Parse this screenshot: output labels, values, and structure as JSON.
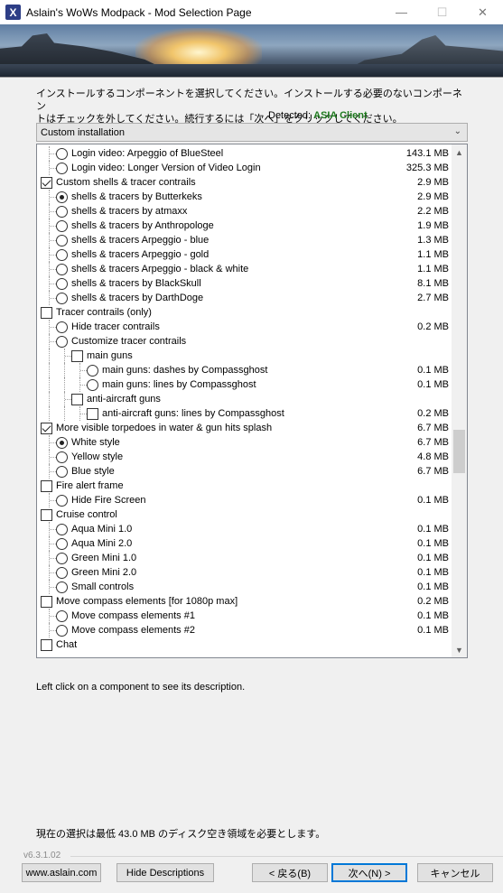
{
  "window": {
    "title": "Aslain's WoWs Modpack - Mod Selection Page",
    "icon": "app-x-icon",
    "controls": {
      "minimize": "—",
      "maximize": "☐",
      "close": "✕"
    }
  },
  "instructions": {
    "line1": "インストールするコンポーネントを選択してください。インストールする必要のないコンポーネン",
    "line2": "トはチェックを外してください。続行するには「次へ」をクリックしてください。",
    "detected_label": "Detected:",
    "detected_value": "ASIA Client"
  },
  "install_type": {
    "selected": "Custom installation"
  },
  "tree": {
    "items": [
      {
        "type": "radio",
        "level": 1,
        "checked": false,
        "label": "Login video: Arpeggio of BlueSteel",
        "size": "143.1 MB"
      },
      {
        "type": "radio",
        "level": 1,
        "checked": false,
        "label": "Login video: Longer Version of Video Login",
        "size": "325.3 MB"
      },
      {
        "type": "check",
        "level": 0,
        "checked": true,
        "label": "Custom shells & tracer contrails",
        "size": "2.9 MB"
      },
      {
        "type": "radio",
        "level": 1,
        "checked": true,
        "label": "shells & tracers by Butterkeks",
        "size": "2.9 MB"
      },
      {
        "type": "radio",
        "level": 1,
        "checked": false,
        "label": "shells & tracers by atmaxx",
        "size": "2.2 MB"
      },
      {
        "type": "radio",
        "level": 1,
        "checked": false,
        "label": "shells & tracers by Anthropologe",
        "size": "1.9 MB"
      },
      {
        "type": "radio",
        "level": 1,
        "checked": false,
        "label": "shells & tracers Arpeggio - blue",
        "size": "1.3 MB"
      },
      {
        "type": "radio",
        "level": 1,
        "checked": false,
        "label": "shells & tracers Arpeggio - gold",
        "size": "1.1 MB"
      },
      {
        "type": "radio",
        "level": 1,
        "checked": false,
        "label": "shells & tracers Arpeggio - black & white",
        "size": "1.1 MB"
      },
      {
        "type": "radio",
        "level": 1,
        "checked": false,
        "label": "shells & tracers by BlackSkull",
        "size": "8.1 MB"
      },
      {
        "type": "radio",
        "level": 1,
        "checked": false,
        "label": "shells & tracers by DarthDoge",
        "size": "2.7 MB"
      },
      {
        "type": "check",
        "level": 0,
        "checked": false,
        "label": "Tracer contrails (only)",
        "size": ""
      },
      {
        "type": "radio",
        "level": 1,
        "checked": false,
        "label": "Hide tracer contrails",
        "size": "0.2 MB"
      },
      {
        "type": "radio",
        "level": 1,
        "checked": false,
        "label": "Customize tracer contrails",
        "size": ""
      },
      {
        "type": "check",
        "level": 2,
        "checked": false,
        "label": "main guns",
        "size": ""
      },
      {
        "type": "radio",
        "level": 3,
        "checked": false,
        "label": "main guns: dashes by Compassghost",
        "size": "0.1 MB"
      },
      {
        "type": "radio",
        "level": 3,
        "checked": false,
        "label": "main guns: lines by Compassghost",
        "size": "0.1 MB"
      },
      {
        "type": "check",
        "level": 2,
        "checked": false,
        "label": "anti-aircraft guns",
        "size": ""
      },
      {
        "type": "check",
        "level": 3,
        "checked": false,
        "label": "anti-aircraft guns: lines by Compassghost",
        "size": "0.2 MB"
      },
      {
        "type": "check",
        "level": 0,
        "checked": true,
        "label": "More visible torpedoes in water & gun hits splash",
        "size": "6.7 MB"
      },
      {
        "type": "radio",
        "level": 1,
        "checked": true,
        "label": "White style",
        "size": "6.7 MB"
      },
      {
        "type": "radio",
        "level": 1,
        "checked": false,
        "label": "Yellow style",
        "size": "4.8 MB"
      },
      {
        "type": "radio",
        "level": 1,
        "checked": false,
        "label": "Blue style",
        "size": "6.7 MB"
      },
      {
        "type": "check",
        "level": 0,
        "checked": false,
        "label": "Fire alert frame",
        "size": ""
      },
      {
        "type": "radio",
        "level": 1,
        "checked": false,
        "label": "Hide Fire Screen",
        "size": "0.1 MB"
      },
      {
        "type": "check",
        "level": 0,
        "checked": false,
        "label": "Cruise control",
        "size": ""
      },
      {
        "type": "radio",
        "level": 1,
        "checked": false,
        "label": "Aqua Mini 1.0",
        "size": "0.1 MB"
      },
      {
        "type": "radio",
        "level": 1,
        "checked": false,
        "label": "Aqua Mini 2.0",
        "size": "0.1 MB"
      },
      {
        "type": "radio",
        "level": 1,
        "checked": false,
        "label": "Green Mini 1.0",
        "size": "0.1 MB"
      },
      {
        "type": "radio",
        "level": 1,
        "checked": false,
        "label": "Green Mini 2.0",
        "size": "0.1 MB"
      },
      {
        "type": "radio",
        "level": 1,
        "checked": false,
        "label": "Small controls",
        "size": "0.1 MB"
      },
      {
        "type": "check",
        "level": 0,
        "checked": false,
        "label": "Move compass elements [for 1080p max]",
        "size": "0.2 MB"
      },
      {
        "type": "radio",
        "level": 1,
        "checked": false,
        "label": "Move compass elements #1",
        "size": "0.1 MB"
      },
      {
        "type": "radio",
        "level": 1,
        "checked": false,
        "label": "Move compass elements #2",
        "size": "0.1 MB"
      },
      {
        "type": "check",
        "level": 0,
        "checked": false,
        "label": "Chat",
        "size": ""
      }
    ]
  },
  "description_hint": "Left click on a component to see its description.",
  "disk_space": "現在の選択は最低 43.0 MB のディスク空き領域を必要とします。",
  "version": "v6.3.1.02",
  "buttons": {
    "website": "www.aslain.com",
    "hide_descriptions": "Hide Descriptions",
    "back": "< 戻る(B)",
    "next": "次へ(N) >",
    "cancel": "キャンセル"
  }
}
